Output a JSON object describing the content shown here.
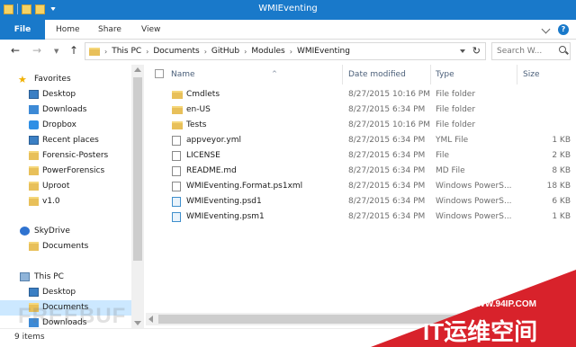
{
  "window": {
    "title": "WMIEventing"
  },
  "ribbon": {
    "tabs": {
      "file": "File",
      "home": "Home",
      "share": "Share",
      "view": "View"
    },
    "help": "?"
  },
  "address": {
    "crumbs": [
      "This PC",
      "Documents",
      "GitHub",
      "Modules",
      "WMIEventing"
    ],
    "search_placeholder": "Search W..."
  },
  "nav": {
    "favorites": "Favorites",
    "favorites_items": [
      "Desktop",
      "Downloads",
      "Dropbox",
      "Recent places",
      "Forensic-Posters",
      "PowerForensics",
      "Uproot",
      "v1.0"
    ],
    "skydrive": "SkyDrive",
    "skydrive_items": [
      "Documents"
    ],
    "this_pc": "This PC",
    "this_pc_items": [
      "Desktop",
      "Documents",
      "Downloads"
    ]
  },
  "columns": {
    "name": "Name",
    "date": "Date modified",
    "type": "Type",
    "size": "Size"
  },
  "files": [
    {
      "name": "Cmdlets",
      "date": "8/27/2015 10:16 PM",
      "type": "File folder",
      "size": "",
      "icon": "folder"
    },
    {
      "name": "en-US",
      "date": "8/27/2015 6:34 PM",
      "type": "File folder",
      "size": "",
      "icon": "folder"
    },
    {
      "name": "Tests",
      "date": "8/27/2015 10:16 PM",
      "type": "File folder",
      "size": "",
      "icon": "folder"
    },
    {
      "name": "appveyor.yml",
      "date": "8/27/2015 6:34 PM",
      "type": "YML File",
      "size": "1 KB",
      "icon": "doc"
    },
    {
      "name": "LICENSE",
      "date": "8/27/2015 6:34 PM",
      "type": "File",
      "size": "2 KB",
      "icon": "doc"
    },
    {
      "name": "README.md",
      "date": "8/27/2015 6:34 PM",
      "type": "MD File",
      "size": "8 KB",
      "icon": "doc"
    },
    {
      "name": "WMIEventing.Format.ps1xml",
      "date": "8/27/2015 6:34 PM",
      "type": "Windows PowerS...",
      "size": "18 KB",
      "icon": "doc"
    },
    {
      "name": "WMIEventing.psd1",
      "date": "8/27/2015 6:34 PM",
      "type": "Windows PowerS...",
      "size": "6 KB",
      "icon": "ps"
    },
    {
      "name": "WMIEventing.psm1",
      "date": "8/27/2015 6:34 PM",
      "type": "Windows PowerS...",
      "size": "1 KB",
      "icon": "ps"
    }
  ],
  "status": {
    "count": "9 items"
  },
  "watermarks": {
    "freebuf": "FREEBUF",
    "url": "WWW.94IP.COM",
    "brand": "IT运维空间"
  }
}
